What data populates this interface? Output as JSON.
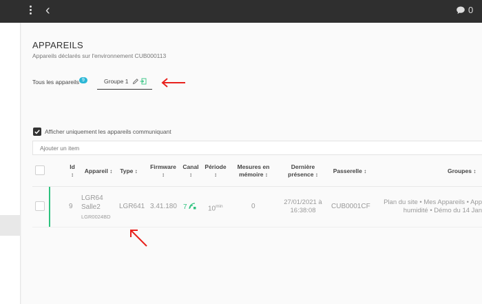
{
  "topbar": {
    "chat_count": "0"
  },
  "page": {
    "title": "APPAREILS",
    "subtitle": "Appareils déclarés sur l'environnement CUB000113"
  },
  "tabs": {
    "all_label": "Tous les appareils",
    "all_count": "9",
    "group_label": "Groupe 1"
  },
  "filter": {
    "label": "Afficher uniquement les appareils communiquant",
    "checked": true
  },
  "search": {
    "placeholder": "Ajouter un item"
  },
  "table": {
    "headers": {
      "id": "Id",
      "appareil": "Appareil",
      "type": "Type",
      "firmware": "Firmware",
      "canal": "Canal",
      "periode": "Période",
      "mesures_line1": "Mesures en",
      "mesures_line2": "mémoire",
      "presence_line1": "Dernière",
      "presence_line2": "présence",
      "passerelle": "Passerelle",
      "groupes": "Groupes"
    },
    "sort_symbol": "↕",
    "rows": [
      {
        "id": "9",
        "name_line1": "LGR64",
        "name_line2": "Salle2",
        "serial": "LGR0024BD",
        "type": "LGR641",
        "firmware": "3.41.180",
        "canal": "7",
        "periode_value": "10",
        "periode_unit": "min",
        "mesures": "0",
        "presence_line1": "27/01/2021 à",
        "presence_line2": "16:38:08",
        "passerelle": "CUB0001CF",
        "groupes_line1": "Plan du site • Mes Appareils • App",
        "groupes_line2": "humidité • Démo du 14 Jan"
      }
    ]
  },
  "colors": {
    "accent_green": "#2ec27e",
    "badge_blue": "#2bb7d6",
    "arrow_red": "#e8201c"
  }
}
